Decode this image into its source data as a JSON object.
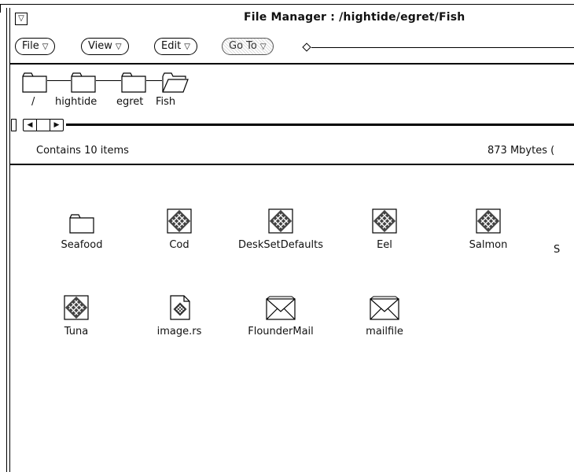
{
  "window": {
    "title": "File Manager : /hightide/egret/Fish",
    "menu_glyph": "▽"
  },
  "menubar": {
    "items": [
      {
        "label": "File",
        "tri": "▽"
      },
      {
        "label": "View",
        "tri": "▽"
      },
      {
        "label": "Edit",
        "tri": "▽"
      },
      {
        "label": "Go To",
        "tri": "▽"
      }
    ]
  },
  "path": {
    "segments": [
      "/",
      "hightide",
      "egret",
      "Fish"
    ]
  },
  "scroll": {
    "left_glyph": "◀",
    "right_glyph": "▶"
  },
  "status": {
    "contains": "Contains 10 items",
    "space": "873 Mbytes ("
  },
  "files": [
    {
      "name": "Seafood",
      "icon": "folder-icon"
    },
    {
      "name": "Cod",
      "icon": "sun-file-icon"
    },
    {
      "name": "DeskSetDefaults",
      "icon": "sun-file-icon"
    },
    {
      "name": "Eel",
      "icon": "sun-file-icon"
    },
    {
      "name": "Salmon",
      "icon": "sun-file-icon"
    },
    {
      "name": "S",
      "icon": "sun-file-icon"
    },
    {
      "name": "Tuna",
      "icon": "sun-file-icon"
    },
    {
      "name": "image.rs",
      "icon": "image-file-icon"
    },
    {
      "name": "FlounderMail",
      "icon": "mail-icon"
    },
    {
      "name": "mailfile",
      "icon": "mail-icon"
    }
  ]
}
